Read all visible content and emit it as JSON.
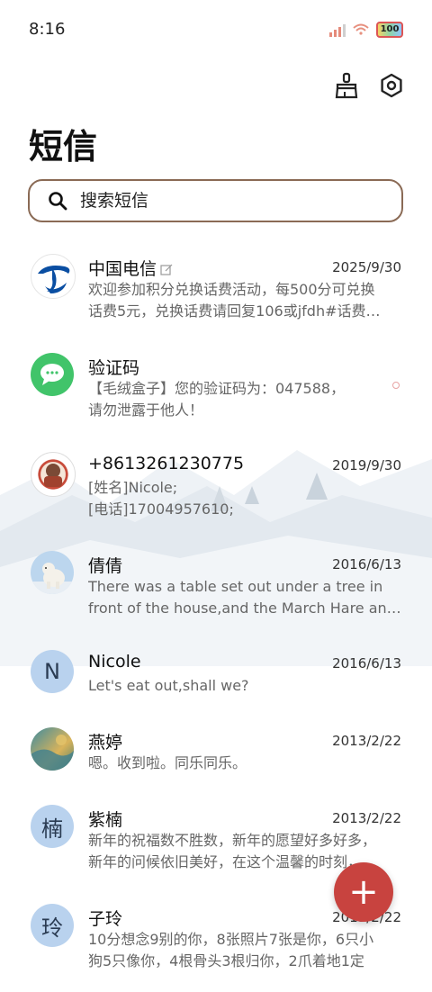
{
  "status_bar": {
    "time": "8:16",
    "battery": "100"
  },
  "header": {
    "title": "短信"
  },
  "search": {
    "placeholder": "搜索短信"
  },
  "conversations": [
    {
      "name": "中国电信",
      "date": "2025/9/30",
      "line1": "欢迎参加积分兑换话费活动，每500分可兑换",
      "line2": "话费5元，兑换话费请回复106或jfdh#话费…",
      "avatar": "china-telecom-logo"
    },
    {
      "name": "验证码",
      "date": "",
      "line1": "【毛绒盒子】您的验证码为：047588，",
      "line2": "请勿泄露于他人！",
      "avatar": "message-bubble-icon"
    },
    {
      "name": "+8613261230775",
      "date": "2019/9/30",
      "line1": "[姓名]Nicole;",
      "line2": "[电话]17004957610;",
      "avatar": "photo"
    },
    {
      "name": "倩倩",
      "date": "2016/6/13",
      "line1": "There was a table set out under a tree in",
      "line2": "front of the house,and the March Hare an…",
      "avatar": "polar-bear-photo"
    },
    {
      "name": "Nicole",
      "date": "2016/6/13",
      "line1": "Let's eat out,shall we?",
      "line2": "",
      "avatar_letter": "N"
    },
    {
      "name": "燕婷",
      "date": "2013/2/22",
      "line1": "嗯。收到啦。同乐同乐。",
      "line2": "",
      "avatar": "landscape-photo"
    },
    {
      "name": "紫楠",
      "date": "2013/2/22",
      "line1": "新年的祝福数不胜数，新年的愿望好多好多，",
      "line2": "新年的问候依旧美好，在这个温馨的时刻，…",
      "avatar_letter": "楠"
    },
    {
      "name": "子玲",
      "date": "2013/2/22",
      "line1": "10分想念9别的你，8张照片7张是你，6只小",
      "line2": "狗5只像你，4根骨头3根归你，2爪着地1定",
      "avatar_letter": "玲"
    }
  ],
  "fab": {
    "label": "+"
  },
  "colors": {
    "accent": "#c8433f",
    "search_border": "#8a6a55",
    "letter_avatar": "#b9d2ee"
  }
}
